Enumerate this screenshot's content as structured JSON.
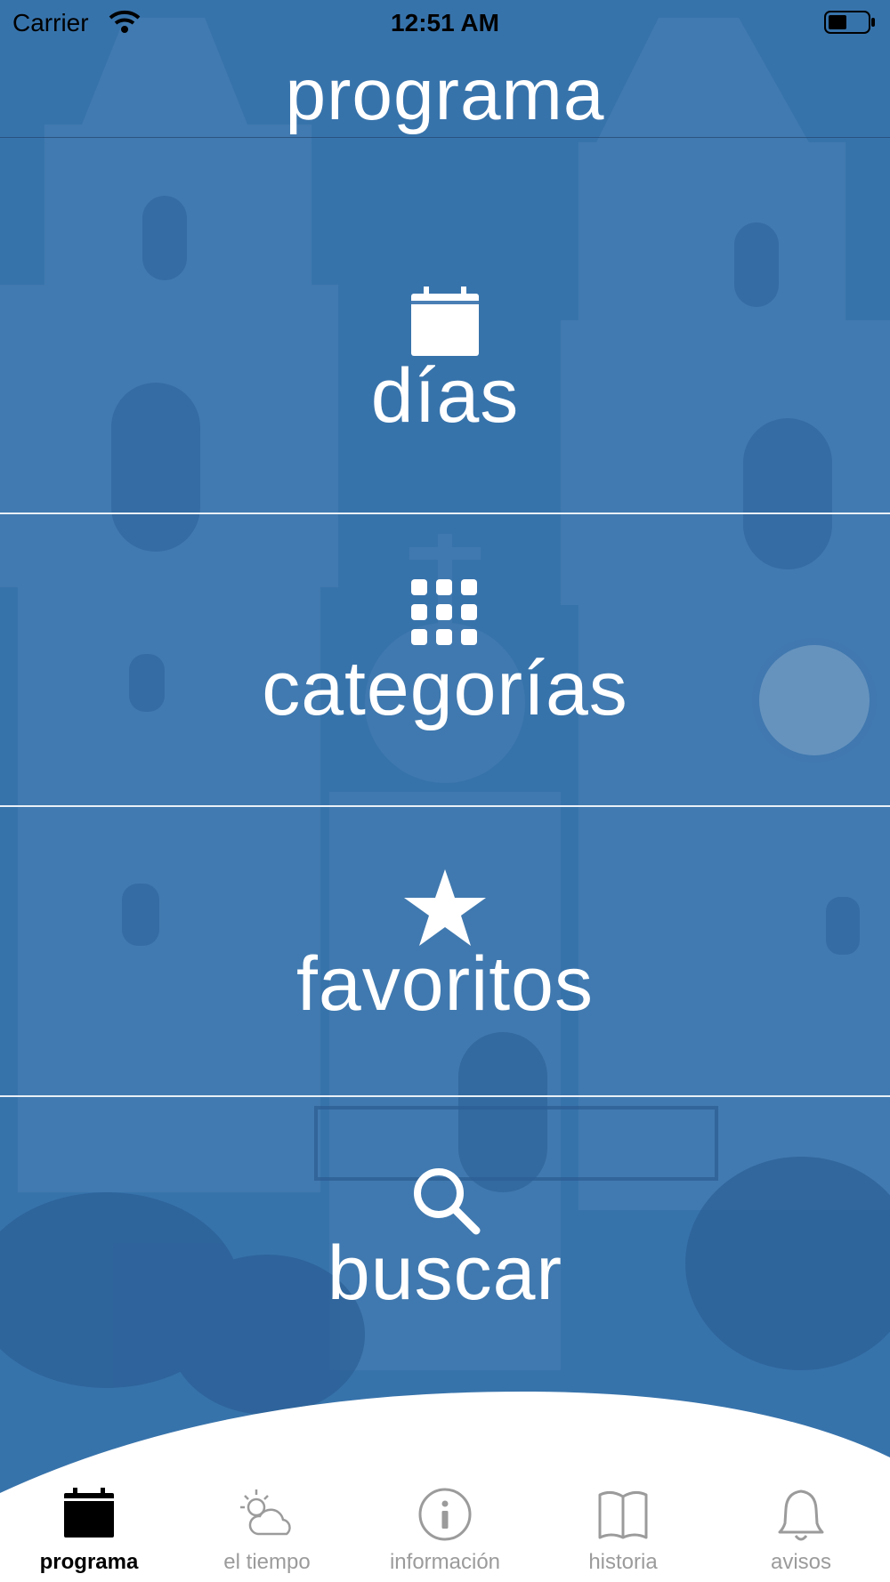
{
  "status_bar": {
    "carrier": "Carrier",
    "time": "12:51 AM",
    "wifi_icon": "wifi-icon",
    "battery_icon": "battery-icon"
  },
  "header": {
    "title": "programa"
  },
  "menu": [
    {
      "label": "días",
      "icon": "calendar-icon"
    },
    {
      "label": "categorías",
      "icon": "grid-icon"
    },
    {
      "label": "favoritos",
      "icon": "star-icon"
    },
    {
      "label": "buscar",
      "icon": "search-icon"
    }
  ],
  "tabs": [
    {
      "label": "programa",
      "icon": "calendar-icon",
      "active": true
    },
    {
      "label": "el tiempo",
      "icon": "weather-icon",
      "active": false
    },
    {
      "label": "información",
      "icon": "info-icon",
      "active": false
    },
    {
      "label": "historia",
      "icon": "book-icon",
      "active": false
    },
    {
      "label": "avisos",
      "icon": "bell-icon",
      "active": false
    }
  ],
  "colors": {
    "overlay_blue": "#2f6aa3",
    "text_white": "#ffffff",
    "tab_active": "#000000",
    "tab_inactive": "#9b9b9b"
  }
}
